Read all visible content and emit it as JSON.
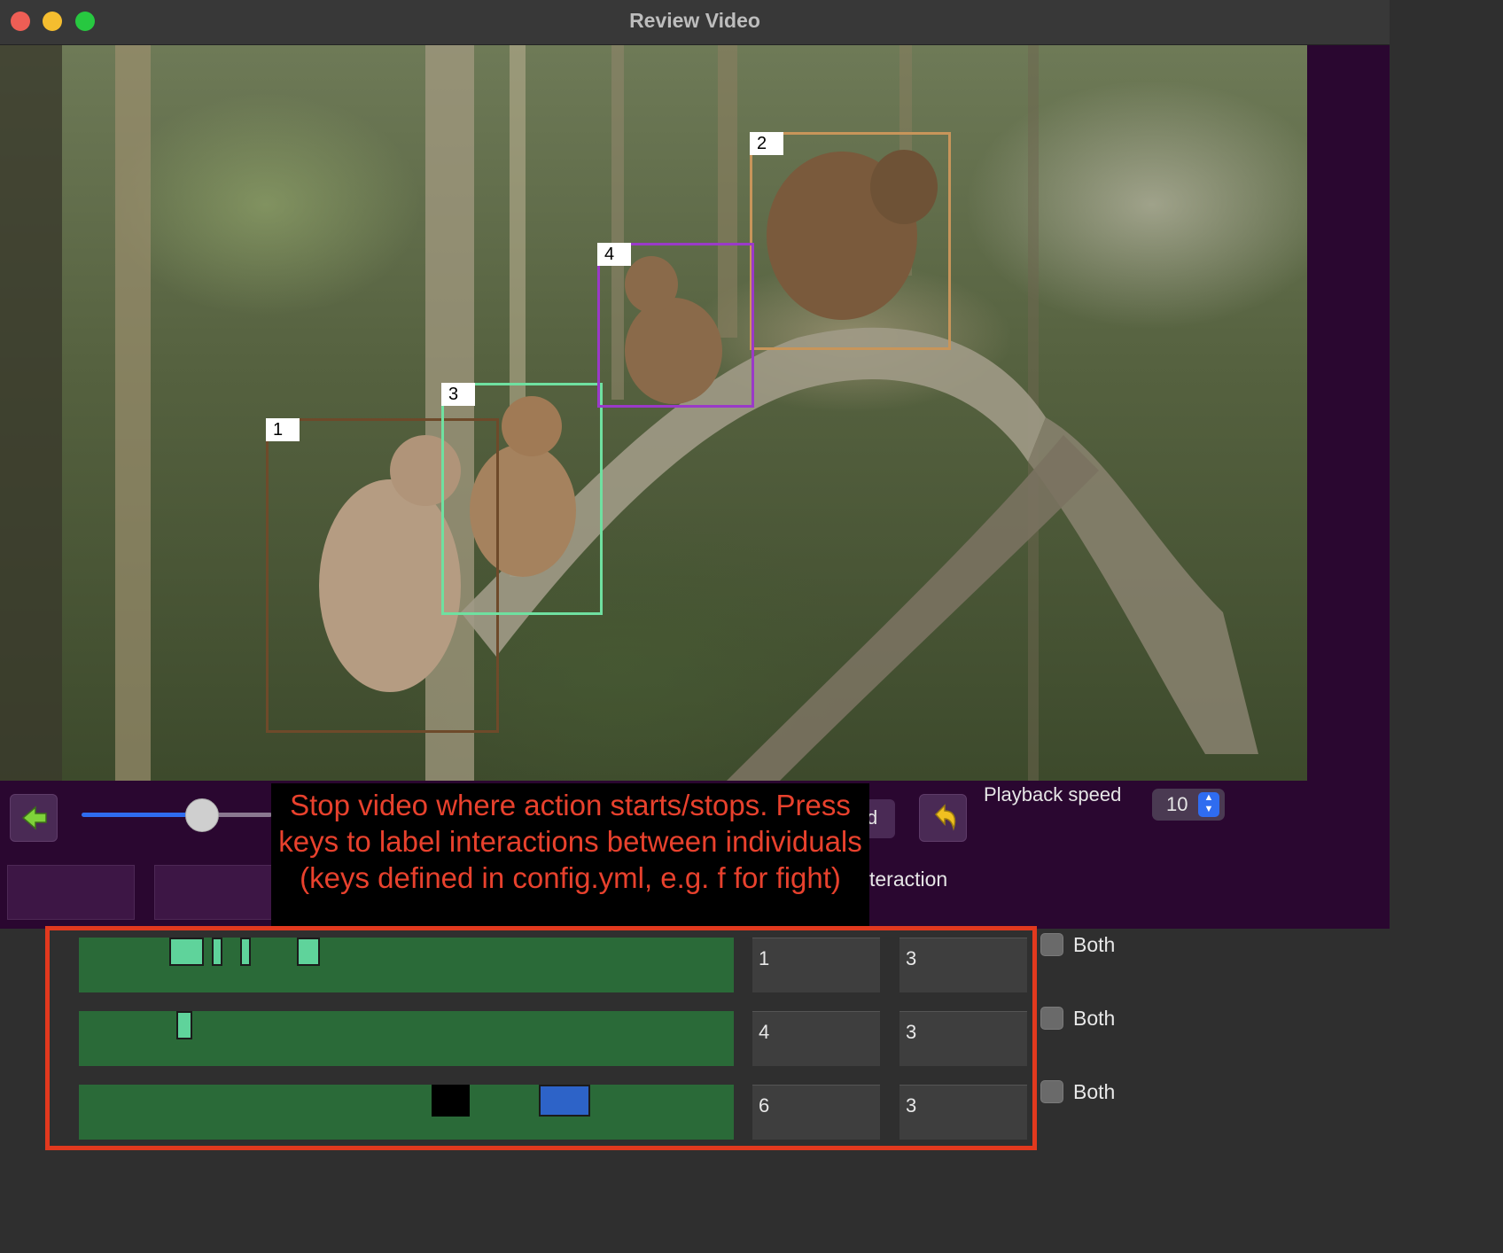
{
  "window": {
    "title": "Review Video",
    "traffic_lights": [
      "#ee5e55",
      "#f5bd2f",
      "#27c840"
    ]
  },
  "video": {
    "description_icon": "video-frame",
    "boxes": [
      {
        "label": "1",
        "color": "#6e4a2a"
      },
      {
        "label": "2",
        "color": "#c8955a"
      },
      {
        "label": "3",
        "color": "#6fe0a0"
      },
      {
        "label": "4",
        "color": "#9a3ac8"
      }
    ]
  },
  "controls": {
    "back_icon": "arrow-left-icon",
    "undo_icon": "undo-arrow-icon",
    "slider_fraction": 0.65,
    "hidden_button_fragment": "d",
    "playback_speed_label": "Playback speed",
    "playback_speed_value": "10",
    "interaction_fragment": "teraction"
  },
  "overlay": {
    "text": "Stop video where action starts/stops. Press keys to label interactions between individuals (keys defined in config.yml, e.g. f for fight)"
  },
  "interactions": [
    {
      "id_a": "1",
      "id_b": "3",
      "both_label": "Both",
      "checked": false
    },
    {
      "id_a": "4",
      "id_b": "3",
      "both_label": "Both",
      "checked": false
    },
    {
      "id_a": "6",
      "id_b": "3",
      "both_label": "Both",
      "checked": false
    }
  ],
  "colors": {
    "accent_red": "#e2391e",
    "track_green": "#2a6a38",
    "event_mint": "#5fd39b",
    "event_black": "#000000",
    "event_blue": "#2d63c8",
    "panel_purple": "#2a0730"
  }
}
